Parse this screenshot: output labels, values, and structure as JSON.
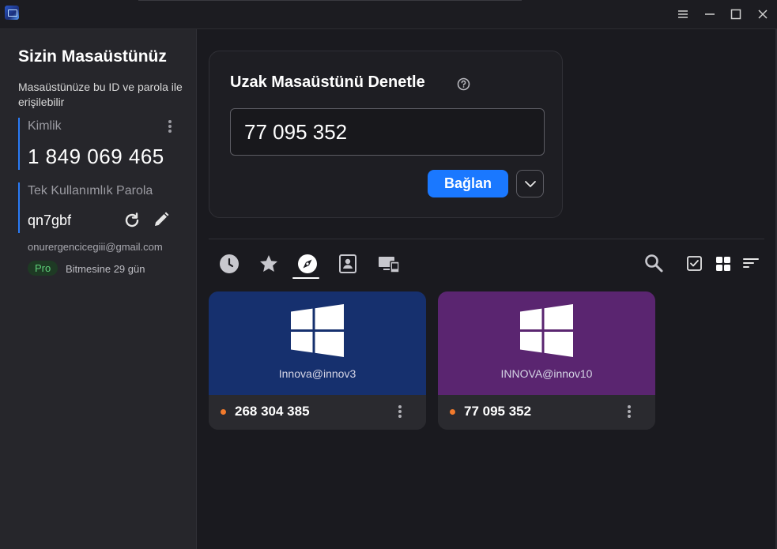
{
  "window": {
    "controls": [
      "menu-icon",
      "minimize-icon",
      "maximize-icon",
      "close-icon"
    ]
  },
  "sidebar": {
    "title": "Sizin Masaüstünüz",
    "description": "Masaüstünüze bu ID ve parola ile erişilebilir",
    "id_label": "Kimlik",
    "id_value": "1 849 069 465",
    "password_label": "Tek Kullanımlık Parola",
    "password_value": "qn7gbf",
    "email": "onurergencicegiii@gmail.com",
    "plan_badge": "Pro",
    "expiry": "Bitmesine 29 gün"
  },
  "control": {
    "title": "Uzak Masaüstünü Denetle",
    "input_value": "77 095 352",
    "connect_label": "Bağlan"
  },
  "tabs": [
    {
      "icon": "history-icon",
      "active": false
    },
    {
      "icon": "favorites-star-icon",
      "active": false
    },
    {
      "icon": "discovered-compass-icon",
      "active": true
    },
    {
      "icon": "address-book-icon",
      "active": false
    },
    {
      "icon": "group-devices-icon",
      "active": false
    }
  ],
  "peers": [
    {
      "user": "Innova@innov3",
      "id": "268 304 385",
      "color": "#16306e",
      "status_color": "#f27a2c"
    },
    {
      "user": "INNOVA@innov10",
      "id": "77 095 352",
      "color": "#5a2570",
      "status_color": "#f27a2c"
    }
  ],
  "colors": {
    "accent": "#1a78ff",
    "sidebar_accent": "#2a7bf6",
    "pro_green": "#5fd07a"
  }
}
